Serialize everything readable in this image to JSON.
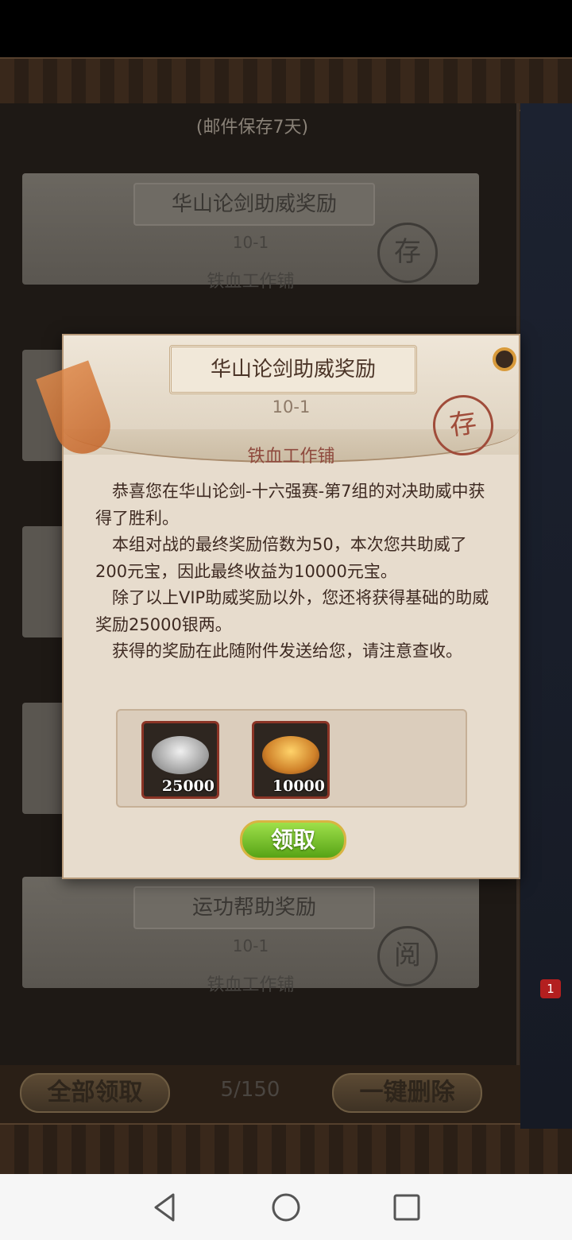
{
  "mail_list": {
    "keep_note": "(邮件保存7天)",
    "items": [
      {
        "title": "华山论剑助威奖励",
        "code": "10-1",
        "sender": "铁血工作铺",
        "stamp": "存"
      },
      {
        "title": "运功帮助奖励",
        "code": "10-1",
        "sender": "铁血工作铺",
        "stamp": "阅"
      }
    ]
  },
  "bottom_bar": {
    "claim_all_label": "全部领取",
    "page_count": "5/150",
    "delete_all_label": "一键删除"
  },
  "side": {
    "chat_badge": "1"
  },
  "modal": {
    "title": "华山论剑助威奖励",
    "code": "10-1",
    "stamp": "存",
    "sender": "铁血工作铺",
    "paragraphs": [
      "恭喜您在华山论剑-十六强赛-第7组的对决助威中获得了胜利。",
      "本组对战的最终奖励倍数为50，本次您共助威了200元宝，因此最终收益为10000元宝。",
      "除了以上VIP助威奖励以外，您还将获得基础的助威奖励25000银两。",
      "获得的奖励在此随附件发送给您，请注意查收。"
    ],
    "attachments": [
      {
        "icon": "silver-ingots-icon",
        "qty": "25000"
      },
      {
        "icon": "gold-ingots-icon",
        "qty": "10000"
      }
    ],
    "claim_label": "领取"
  },
  "colors": {
    "modal_bg": "#e7dccd",
    "stamp_red": "#a04c3a",
    "claim_green": "#6fb825",
    "item_border": "#8b3426"
  }
}
